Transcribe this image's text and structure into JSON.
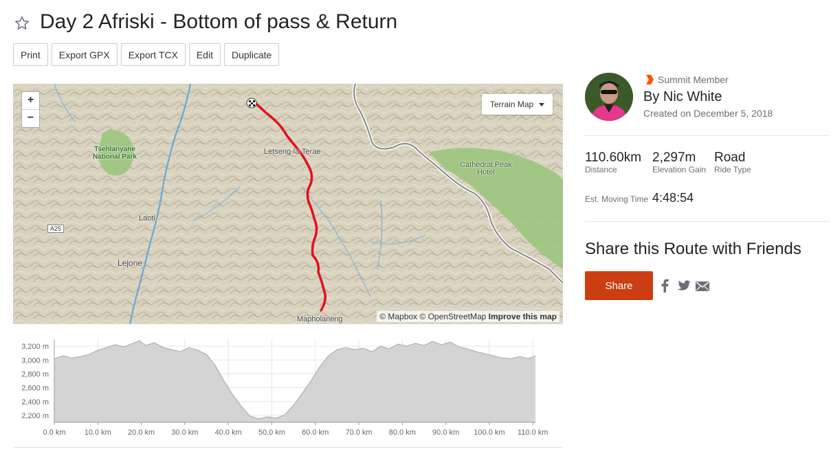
{
  "route": {
    "title": "Day 2 Afriski - Bottom of pass & Return"
  },
  "toolbar": {
    "buttons": [
      "Print",
      "Export GPX",
      "Export TCX",
      "Edit",
      "Duplicate"
    ]
  },
  "map": {
    "zoom_in": "+",
    "zoom_out": "−",
    "map_type": "Terrain Map",
    "attribution_mapbox": "© Mapbox",
    "attribution_osm": "© OpenStreetMap",
    "attribution_improve": "Improve this map",
    "labels": {
      "park": "Tsehlanyane National Park",
      "cathedral": "Cathedral Peak Hotel",
      "letseng": "Letseng-la-Terae",
      "laoti": "Laoti",
      "lejone": "Lejone",
      "mapholaneng": "Mapholaneng",
      "road": "A25"
    },
    "route_color": "#e3101c"
  },
  "chart_data": {
    "type": "area",
    "xlabel": "",
    "ylabel": "",
    "x_ticks": [
      "0.0 km",
      "10.0 km",
      "20.0 km",
      "30.0 km",
      "40.0 km",
      "50.0 km",
      "60.0 km",
      "70.0 km",
      "80.0 km",
      "90.0 km",
      "100.0 km",
      "110.0 km"
    ],
    "y_ticks": [
      "2,200 m",
      "2,400 m",
      "2,600 m",
      "2,800 m",
      "3,000 m",
      "3,200 m"
    ],
    "xlim": [
      0,
      110.6
    ],
    "ylim": [
      2100,
      3300
    ],
    "x": [
      0,
      2,
      4,
      6,
      8,
      10,
      12,
      14,
      16,
      18,
      19.5,
      21,
      23,
      25,
      27,
      29,
      31,
      33,
      35,
      37,
      39,
      41,
      43,
      45,
      47,
      49,
      51,
      53,
      55,
      57,
      59,
      61,
      63,
      65,
      67,
      69,
      71,
      73,
      75,
      77,
      79,
      81,
      83,
      85,
      87,
      89,
      91,
      93,
      95,
      97,
      99,
      101,
      103,
      105,
      107,
      109,
      110.6
    ],
    "y": [
      3020,
      3060,
      3030,
      3050,
      3080,
      3140,
      3180,
      3220,
      3190,
      3240,
      3280,
      3210,
      3250,
      3180,
      3150,
      3120,
      3180,
      3140,
      3080,
      2920,
      2700,
      2500,
      2330,
      2190,
      2150,
      2180,
      2160,
      2210,
      2350,
      2520,
      2700,
      2900,
      3060,
      3150,
      3180,
      3150,
      3170,
      3120,
      3200,
      3160,
      3230,
      3200,
      3240,
      3210,
      3270,
      3220,
      3260,
      3190,
      3160,
      3120,
      3090,
      3060,
      3030,
      3020,
      3050,
      3020,
      3060
    ],
    "fill_color": "#d4d4d4",
    "line_color": "#a8a8a8"
  },
  "author": {
    "badge": "Summit Member",
    "byline": "By Nic White",
    "created": "Created on December 5, 2018"
  },
  "stats": {
    "distance_value": "110.60km",
    "distance_label": "Distance",
    "elevation_value": "2,297m",
    "elevation_label": "Elevation Gain",
    "ride_type_value": "Road",
    "ride_type_label": "Ride Type",
    "moving_time_label": "Est. Moving Time",
    "moving_time_value": "4:48:54"
  },
  "share": {
    "title": "Share this Route with Friends",
    "button": "Share"
  },
  "icons": {
    "star": "star-outline-icon",
    "badge": "summit-chevron-icon",
    "facebook": "facebook-icon",
    "twitter": "twitter-icon",
    "email": "email-icon"
  },
  "colors": {
    "accent": "#cc3e12",
    "badge": "#fc5200",
    "park_green": "#8cc06a"
  }
}
